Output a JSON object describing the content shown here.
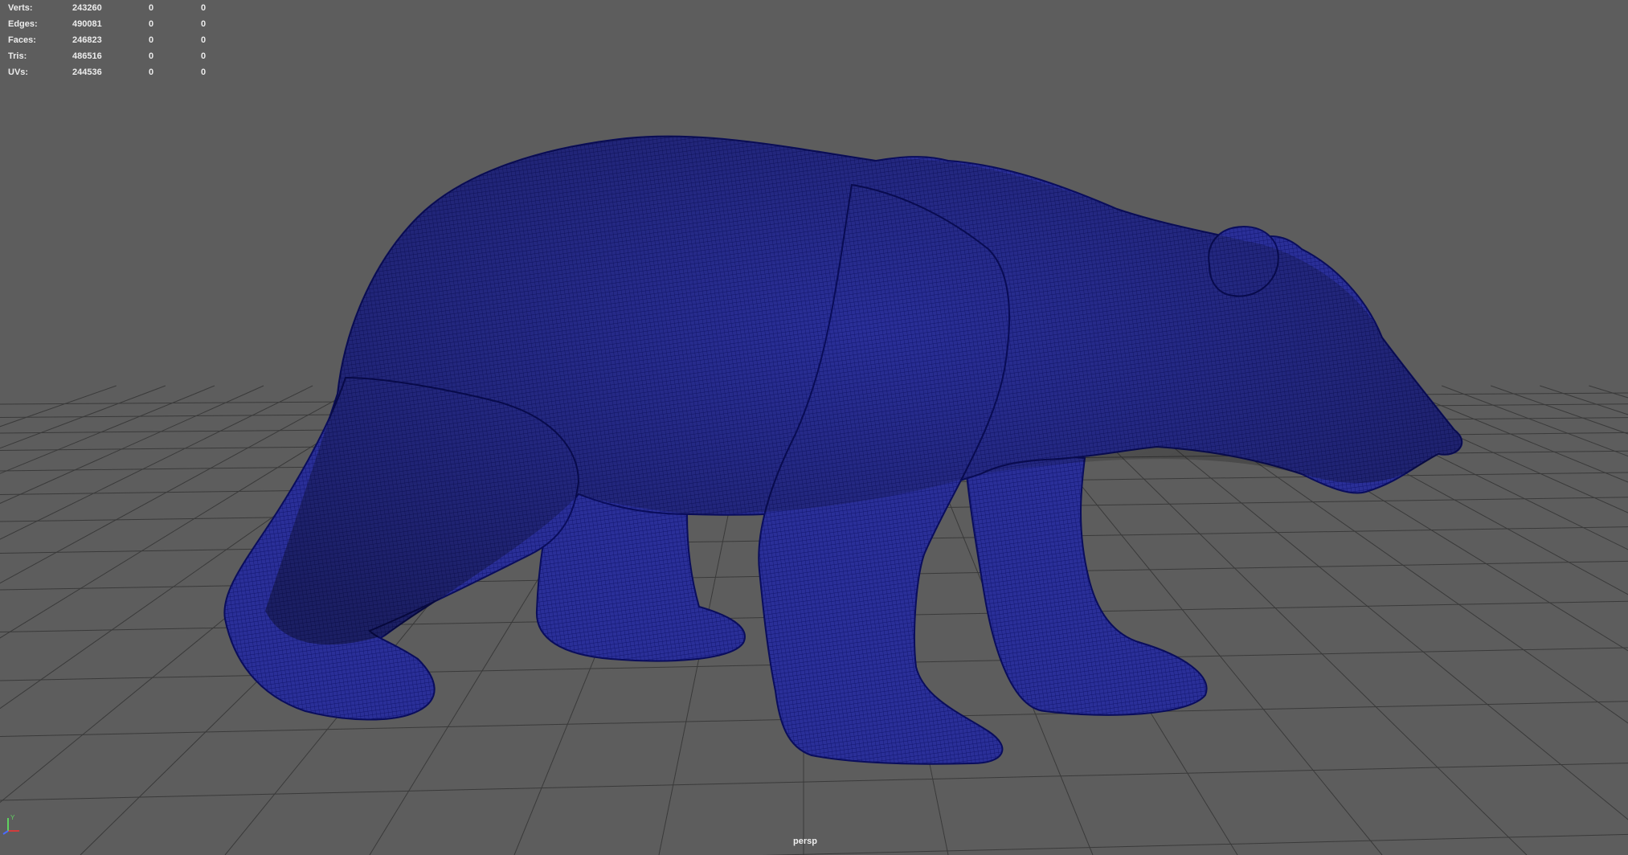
{
  "hud": {
    "rows": [
      {
        "label": "Verts:",
        "total": "243260",
        "selected": "0",
        "component": "0"
      },
      {
        "label": "Edges:",
        "total": "490081",
        "selected": "0",
        "component": "0"
      },
      {
        "label": "Faces:",
        "total": "246823",
        "selected": "0",
        "component": "0"
      },
      {
        "label": "Tris:",
        "total": "486516",
        "selected": "0",
        "component": "0"
      },
      {
        "label": "UVs:",
        "total": "244536",
        "selected": "0",
        "component": "0"
      }
    ]
  },
  "viewport": {
    "camera_label": "persp",
    "background_color": "#5d5d5d",
    "grid_color": "#3a3a3a",
    "mesh_color": "#272d95",
    "wire_color": "#0f136d",
    "subject": "polar-bear-mesh"
  },
  "axis_gizmo": {
    "x_color": "#d23c3c",
    "y_color": "#5fd25f",
    "z_color": "#4b6bff",
    "y_label": "Y"
  }
}
